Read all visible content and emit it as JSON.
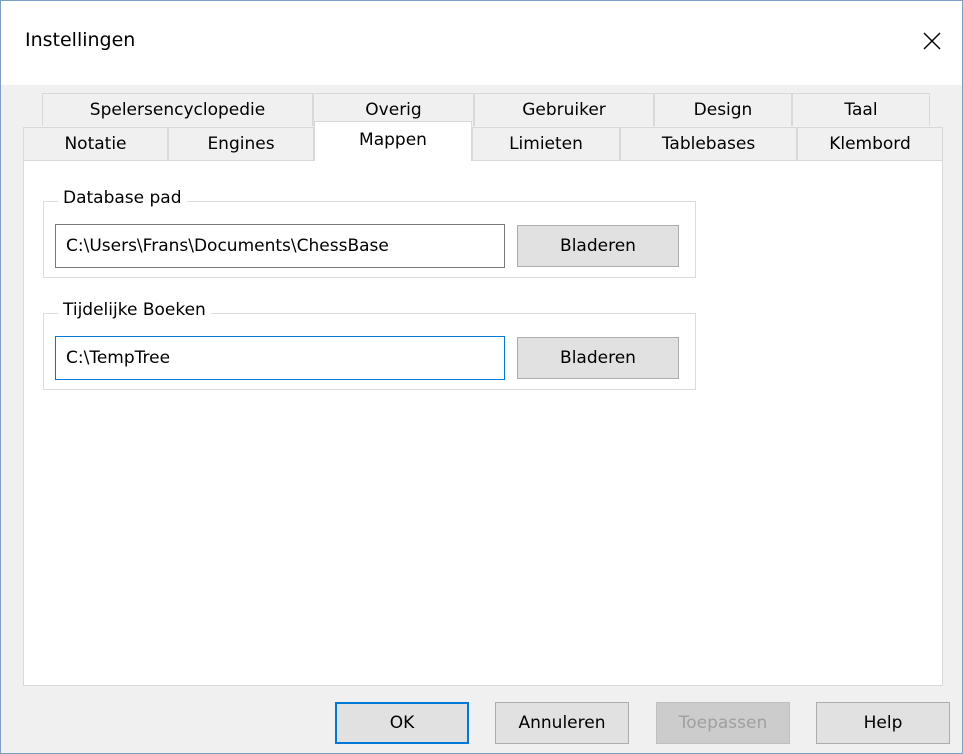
{
  "window": {
    "title": "Instellingen",
    "close_icon": "close-icon"
  },
  "tabs": {
    "row1": [
      "Spelersencyclopedie",
      "Overig",
      "Gebruiker",
      "Design",
      "Taal"
    ],
    "row2": [
      "Notatie",
      "Engines",
      "Mappen",
      "Limieten",
      "Tablebases",
      "Klembord"
    ],
    "active": "Mappen"
  },
  "database_path": {
    "label": "Database pad",
    "value": "C:\\Users\\Frans\\Documents\\ChessBase",
    "browse_label": "Bladeren"
  },
  "temp_books": {
    "label": "Tijdelijke Boeken",
    "value": "C:\\TempTree",
    "browse_label": "Bladeren"
  },
  "buttons": {
    "ok": "OK",
    "cancel": "Annuleren",
    "apply": "Toepassen",
    "help": "Help"
  },
  "colors": {
    "focus_accent": "#0078d7",
    "panel_background": "#ffffff",
    "window_background": "#f0f0f0"
  }
}
